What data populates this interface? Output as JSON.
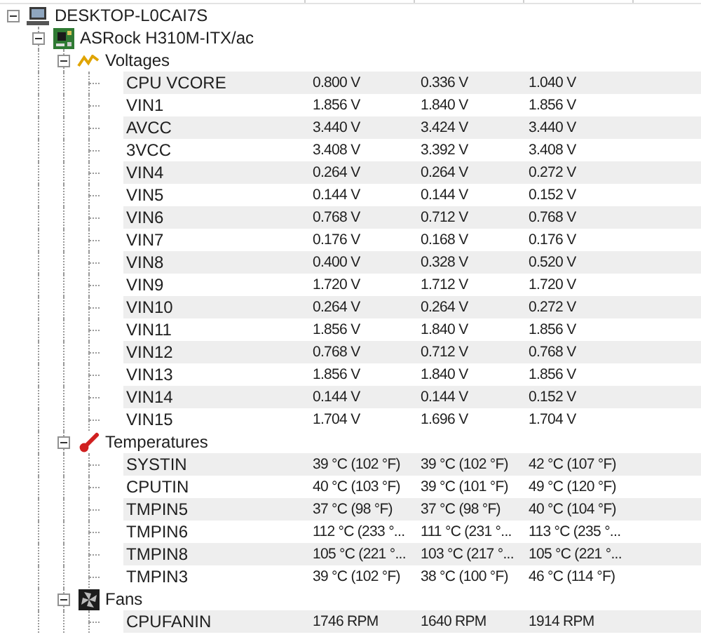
{
  "tree": {
    "label": "DESKTOP-L0CAI7S",
    "kind": "computer",
    "expanded": true,
    "children": [
      {
        "label": "ASRock H310M-ITX/ac",
        "kind": "board",
        "expanded": true,
        "children": [
          {
            "label": "Voltages",
            "kind": "voltage",
            "expanded": true,
            "children": [
              {
                "label": "CPU VCORE",
                "values": [
                  "0.800 V",
                  "0.336 V",
                  "1.040 V"
                ]
              },
              {
                "label": "VIN1",
                "values": [
                  "1.856 V",
                  "1.840 V",
                  "1.856 V"
                ]
              },
              {
                "label": "AVCC",
                "values": [
                  "3.440 V",
                  "3.424 V",
                  "3.440 V"
                ]
              },
              {
                "label": "3VCC",
                "values": [
                  "3.408 V",
                  "3.392 V",
                  "3.408 V"
                ]
              },
              {
                "label": "VIN4",
                "values": [
                  "0.264 V",
                  "0.264 V",
                  "0.272 V"
                ]
              },
              {
                "label": "VIN5",
                "values": [
                  "0.144 V",
                  "0.144 V",
                  "0.152 V"
                ]
              },
              {
                "label": "VIN6",
                "values": [
                  "0.768 V",
                  "0.712 V",
                  "0.768 V"
                ]
              },
              {
                "label": "VIN7",
                "values": [
                  "0.176 V",
                  "0.168 V",
                  "0.176 V"
                ]
              },
              {
                "label": "VIN8",
                "values": [
                  "0.400 V",
                  "0.328 V",
                  "0.520 V"
                ]
              },
              {
                "label": "VIN9",
                "values": [
                  "1.720 V",
                  "1.712 V",
                  "1.720 V"
                ]
              },
              {
                "label": "VIN10",
                "values": [
                  "0.264 V",
                  "0.264 V",
                  "0.272 V"
                ]
              },
              {
                "label": "VIN11",
                "values": [
                  "1.856 V",
                  "1.840 V",
                  "1.856 V"
                ]
              },
              {
                "label": "VIN12",
                "values": [
                  "0.768 V",
                  "0.712 V",
                  "0.768 V"
                ]
              },
              {
                "label": "VIN13",
                "values": [
                  "1.856 V",
                  "1.840 V",
                  "1.856 V"
                ]
              },
              {
                "label": "VIN14",
                "values": [
                  "0.144 V",
                  "0.144 V",
                  "0.152 V"
                ]
              },
              {
                "label": "VIN15",
                "values": [
                  "1.704 V",
                  "1.696 V",
                  "1.704 V"
                ]
              }
            ]
          },
          {
            "label": "Temperatures",
            "kind": "temperature",
            "expanded": true,
            "children": [
              {
                "label": "SYSTIN",
                "values": [
                  "39 °C (102 °F)",
                  "39 °C (102 °F)",
                  "42 °C (107 °F)"
                ]
              },
              {
                "label": "CPUTIN",
                "values": [
                  "40 °C (103 °F)",
                  "39 °C (101 °F)",
                  "49 °C (120 °F)"
                ]
              },
              {
                "label": "TMPIN5",
                "values": [
                  "37 °C (98 °F)",
                  "37 °C (98 °F)",
                  "40 °C (104 °F)"
                ]
              },
              {
                "label": "TMPIN6",
                "values": [
                  "112 °C (233 °...",
                  "111 °C (231 °...",
                  "113 °C (235 °..."
                ]
              },
              {
                "label": "TMPIN8",
                "values": [
                  "105 °C (221 °...",
                  "103 °C (217 °...",
                  "105 °C (221 °..."
                ]
              },
              {
                "label": "TMPIN3",
                "values": [
                  "39 °C (102 °F)",
                  "38 °C (100 °F)",
                  "46 °C (114 °F)"
                ]
              }
            ]
          },
          {
            "label": "Fans",
            "kind": "fan",
            "expanded": true,
            "children": [
              {
                "label": "CPUFANIN",
                "values": [
                  "1746 RPM",
                  "1640 RPM",
                  "1914 RPM"
                ]
              }
            ]
          }
        ]
      }
    ]
  }
}
